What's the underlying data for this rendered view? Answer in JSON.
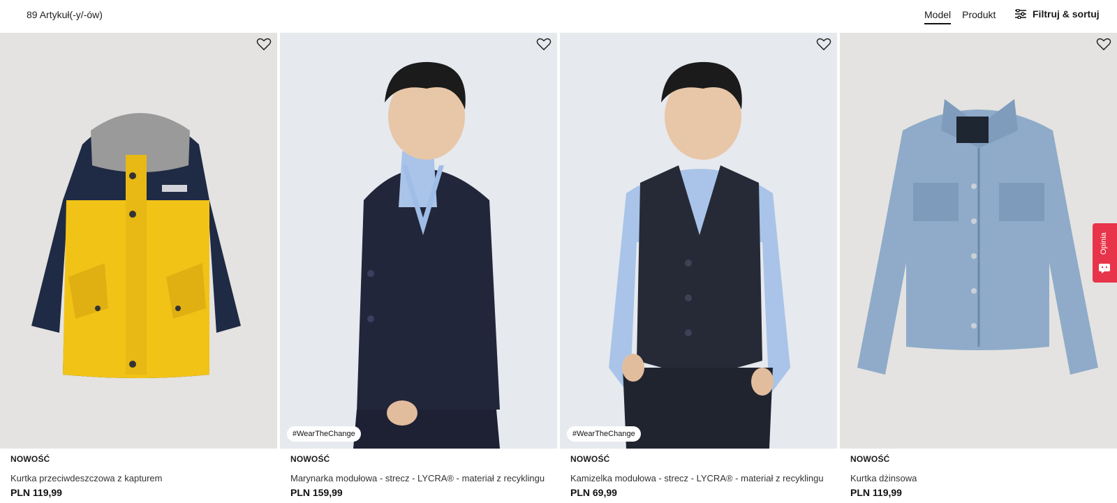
{
  "header": {
    "item_count": "89 Artykuł(-y/-ów)",
    "view_model": "Model",
    "view_product": "Produkt",
    "filter_label": "Filtruj & sortuj"
  },
  "products": [
    {
      "badge": "NOWOŚĆ",
      "name": "Kurtka przeciwdeszczowa z kapturem",
      "price": "PLN 119,99",
      "tag": ""
    },
    {
      "badge": "NOWOŚĆ",
      "name": "Marynarka modułowa - strecz - LYCRA® - materiał z recyklingu",
      "price": "PLN 159,99",
      "tag": "#WearTheChange"
    },
    {
      "badge": "NOWOŚĆ",
      "name": "Kamizelka modułowa - strecz - LYCRA® - materiał z recyklingu",
      "price": "PLN 69,99",
      "tag": "#WearTheChange"
    },
    {
      "badge": "NOWOŚĆ",
      "name": "Kurtka dżinsowa",
      "price": "PLN 119,99",
      "tag": ""
    }
  ],
  "feedback": {
    "label": "Opinia",
    "color": "#e8344a"
  },
  "icons": {
    "wishlist": "heart-icon",
    "filter": "sliders-icon",
    "feedback": "chat-icon"
  }
}
